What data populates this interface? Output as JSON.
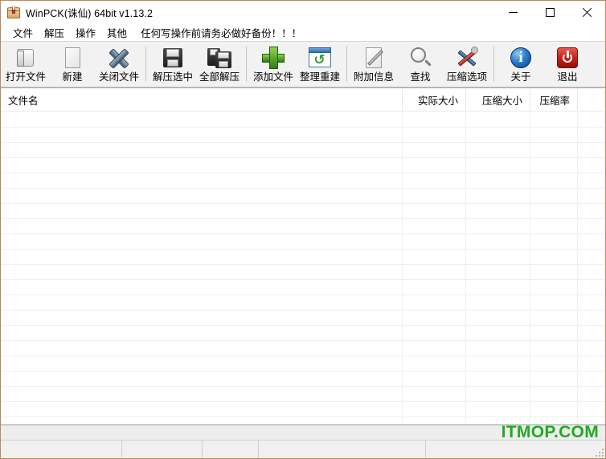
{
  "window": {
    "title": "WinPCK(诛仙) 64bit v1.13.2",
    "icon": "package-box-icon",
    "controls": {
      "minimize": "minimize-icon",
      "maximize": "maximize-icon",
      "close": "close-icon"
    }
  },
  "menubar": {
    "items": [
      {
        "label": "文件"
      },
      {
        "label": "解压"
      },
      {
        "label": "操作"
      },
      {
        "label": "其他"
      }
    ],
    "note": "任何写操作前请务必做好备份！！！"
  },
  "toolbar": {
    "buttons": [
      {
        "label": "打开文件",
        "icon": "folder-open-icon"
      },
      {
        "label": "新建",
        "icon": "new-file-icon"
      },
      {
        "label": "关闭文件",
        "icon": "close-file-x-icon"
      },
      {
        "label": "解压选中",
        "icon": "floppy-save-icon"
      },
      {
        "label": "全部解压",
        "icon": "floppy-save-all-icon"
      },
      {
        "label": "添加文件",
        "icon": "green-plus-icon"
      },
      {
        "label": "整理重建",
        "icon": "rebuild-refresh-icon"
      },
      {
        "label": "附加信息",
        "icon": "pencil-note-icon"
      },
      {
        "label": "查找",
        "icon": "magnifier-icon"
      },
      {
        "label": "压缩选项",
        "icon": "tools-icon"
      },
      {
        "label": "关于",
        "icon": "info-icon"
      },
      {
        "label": "退出",
        "icon": "power-exit-icon"
      }
    ]
  },
  "filelist": {
    "columns": [
      {
        "label": "文件名",
        "align": "left"
      },
      {
        "label": "实际大小",
        "align": "right"
      },
      {
        "label": "压缩大小",
        "align": "right"
      },
      {
        "label": "压缩率",
        "align": "right"
      }
    ],
    "rows": []
  },
  "statusbar": {
    "panels": [
      "",
      "",
      "",
      "",
      ""
    ],
    "watermark": "ITMOP.COM"
  },
  "colors": {
    "window_border": "#b98a58",
    "toolbar_bg": "#f2f2f2",
    "statusbar_bg": "#f0f0f0",
    "watermark": "#22aa22",
    "grid_line": "#efefef"
  }
}
